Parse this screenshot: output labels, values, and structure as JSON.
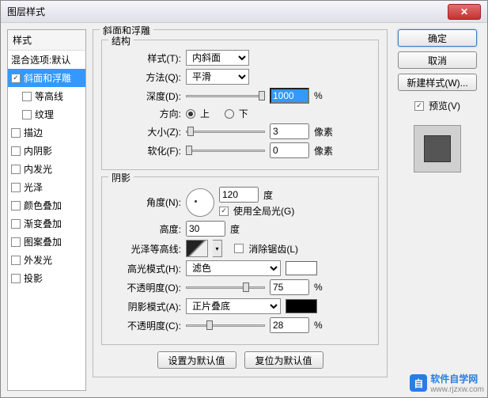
{
  "window": {
    "title": "图层样式"
  },
  "sidebar": {
    "header": "样式",
    "blend": "混合选项:默认",
    "items": [
      {
        "label": "斜面和浮雕",
        "checked": true,
        "selected": true
      },
      {
        "label": "等高线",
        "checked": false,
        "indent": true
      },
      {
        "label": "纹理",
        "checked": false,
        "indent": true
      },
      {
        "label": "描边",
        "checked": false
      },
      {
        "label": "内阴影",
        "checked": false
      },
      {
        "label": "内发光",
        "checked": false
      },
      {
        "label": "光泽",
        "checked": false
      },
      {
        "label": "颜色叠加",
        "checked": false
      },
      {
        "label": "渐变叠加",
        "checked": false
      },
      {
        "label": "图案叠加",
        "checked": false
      },
      {
        "label": "外发光",
        "checked": false
      },
      {
        "label": "投影",
        "checked": false
      }
    ]
  },
  "panel": {
    "title": "斜面和浮雕",
    "structure": {
      "title": "结构",
      "style_label": "样式(T):",
      "style_value": "内斜面",
      "technique_label": "方法(Q):",
      "technique_value": "平滑",
      "depth_label": "深度(D):",
      "depth_value": "1000",
      "depth_unit": "%",
      "direction_label": "方向:",
      "up": "上",
      "down": "下",
      "size_label": "大小(Z):",
      "size_value": "3",
      "size_unit": "像素",
      "soften_label": "软化(F):",
      "soften_value": "0",
      "soften_unit": "像素"
    },
    "shading": {
      "title": "阴影",
      "angle_label": "角度(N):",
      "angle_value": "120",
      "angle_unit": "度",
      "global_label": "使用全局光(G)",
      "altitude_label": "高度:",
      "altitude_value": "30",
      "altitude_unit": "度",
      "gloss_label": "光泽等高线:",
      "antialias_label": "消除锯齿(L)",
      "hmode_label": "高光模式(H):",
      "hmode_value": "滤色",
      "hopacity_label": "不透明度(O):",
      "hopacity_value": "75",
      "pct": "%",
      "smode_label": "阴影模式(A):",
      "smode_value": "正片叠底",
      "sopacity_label": "不透明度(C):",
      "sopacity_value": "28",
      "highlight_color": "#ffffff",
      "shadow_color": "#000000"
    },
    "defaults": {
      "set": "设置为默认值",
      "reset": "复位为默认值"
    }
  },
  "buttons": {
    "ok": "确定",
    "cancel": "取消",
    "newstyle": "新建样式(W)...",
    "preview": "预览(V)"
  },
  "watermark": {
    "badge": "自",
    "text1": "软件自学网",
    "text2": "www.rjzxw.com"
  }
}
